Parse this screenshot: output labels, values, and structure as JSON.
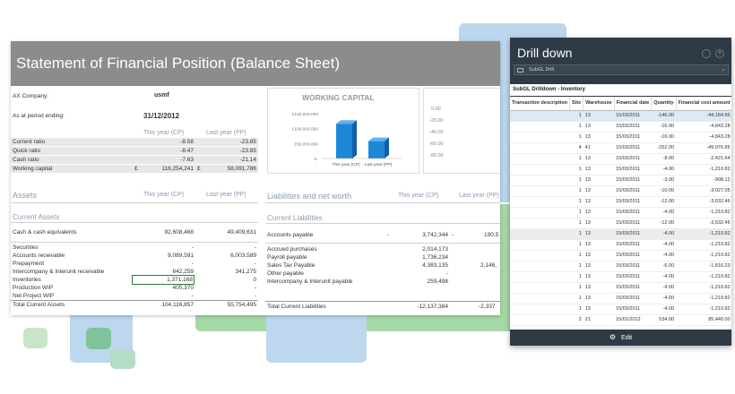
{
  "colors": {
    "accent_blue": "#bcd7ee",
    "accent_green": "#a7d9a6",
    "drill_header": "#2e3a46",
    "title_bar": "#8c8c8c",
    "bar_blue": "#1e88d8"
  },
  "sheet": {
    "title": "Statement of Financial Position (Balance Sheet)",
    "company_label": "AX Company:",
    "company_value": "usmf",
    "period_label": "As at period ending:",
    "period_value": "31/12/2012",
    "col_cp": "This year (CP)",
    "col_pp": "Last year (PP)",
    "ratios": [
      {
        "label": "Current ratio",
        "cp": "-8.58",
        "pp": "-23.85"
      },
      {
        "label": "Quick ratio",
        "cp": "-8.47",
        "pp": "-23.85"
      },
      {
        "label": "Cash ratio",
        "cp": "-7.63",
        "pp": "-21.14"
      },
      {
        "label": "Working capital",
        "cur": "£",
        "cp": "116,254,241",
        "cur2": "£",
        "pp": "58,091,786"
      }
    ],
    "assets_heading": "Assets",
    "current_assets_heading": "Current Assets",
    "cash_row": {
      "label": "Cash & cash equivalents",
      "cp": "92,608,468",
      "pp": "49,409,631"
    },
    "asset_rows": [
      {
        "label": "Securities",
        "cp": "-",
        "pp": "-"
      },
      {
        "label": "Accounts receivable",
        "cp": "9,089,591",
        "pp": "6,003,589"
      },
      {
        "label": "Prepayment",
        "cp": "-",
        "pp": "-"
      },
      {
        "label": "Intercompany & Interunit receivable",
        "cp": "642,259",
        "pp": "341,275"
      },
      {
        "label": "Inventories",
        "cp": "1,371,168",
        "pp": "0"
      },
      {
        "label": "Production WIP",
        "cp": "405,370",
        "pp": "-"
      },
      {
        "label": "Net Project WIP",
        "cp": "-",
        "pp": "-"
      }
    ],
    "total_assets": {
      "label": "Total Current Assets",
      "cp": "104,116,857",
      "pp": "55,754,495"
    },
    "liab_heading": "Liabilities and net worth",
    "current_liab_heading": "Current Liabilities",
    "ap_row": {
      "label": "Accounts payable",
      "dash": "-",
      "cp": "3,742,344",
      "dash2": "-",
      "pp": "190,5"
    },
    "liab_rows": [
      {
        "label": "Accrued purchases",
        "cp": "2,014,173",
        "pp": ""
      },
      {
        "label": "Payroll payable",
        "cp": "1,736,234",
        "pp": ""
      },
      {
        "label": "Sales Tax Payable",
        "cp": "4,383,135",
        "pp": "2,146,"
      },
      {
        "label": "Other payable",
        "cp": "-",
        "pp": ""
      },
      {
        "label": "Intercompany & Interunit payable",
        "cp": "259,498",
        "pp": ""
      }
    ],
    "total_liab": {
      "label": "Total Current Liabilities",
      "cp": "-12,137,384",
      "pp": "-2,337"
    },
    "chart": {
      "title": "WORKING CAPITAL",
      "y_ticks": [
        "£150,000,000",
        "£100,000,000",
        "£50,000,000",
        "£-"
      ],
      "categories": [
        "This year (CP)",
        "Last year (PP)"
      ]
    },
    "chart2_ticks": [
      "0.00",
      "-20.00",
      "-40.00",
      "-60.00",
      "-80.00"
    ]
  },
  "chart_data": {
    "type": "bar",
    "title": "WORKING CAPITAL",
    "categories": [
      "This year (CP)",
      "Last year (PP)"
    ],
    "values": [
      116254241,
      58091786
    ],
    "ylim": [
      0,
      150000000
    ]
  },
  "drill": {
    "title": "Drill down",
    "select_value": "SubGL Drill",
    "subtitle": "SubGL Drilldown - Inventory",
    "columns": [
      "Transaction description",
      "Site",
      "Warehouse",
      "Financial date",
      "Quantity",
      "Financial cost amount"
    ],
    "rows": [
      [
        "",
        "1",
        "13",
        "15/03/2011",
        "-146.00",
        "-44,184.96"
      ],
      [
        "",
        "1",
        "13",
        "15/03/2011",
        "-16.00",
        "-4,843.28"
      ],
      [
        "",
        "1",
        "13",
        "15/03/2011",
        "-16.00",
        "-4,843.28"
      ],
      [
        "",
        "4",
        "41",
        "15/03/2011",
        "-252.00",
        "-49,976.86"
      ],
      [
        "",
        "1",
        "13",
        "15/03/2011",
        "-8.00",
        "-2,421.64"
      ],
      [
        "",
        "1",
        "13",
        "15/03/2011",
        "-4.00",
        "-1,210.82"
      ],
      [
        "",
        "1",
        "13",
        "15/03/2011",
        "-3.00",
        "-908.12"
      ],
      [
        "",
        "1",
        "13",
        "15/03/2011",
        "-10.00",
        "-3,027.05"
      ],
      [
        "",
        "1",
        "13",
        "15/03/2011",
        "-12.00",
        "-3,632.46"
      ],
      [
        "",
        "1",
        "13",
        "15/03/2011",
        "-4.00",
        "-1,210.82"
      ],
      [
        "",
        "1",
        "13",
        "15/03/2011",
        "-12.00",
        "-3,632.46"
      ],
      [
        "",
        "1",
        "13",
        "15/03/2011",
        "-4.00",
        "-1,210.82"
      ],
      [
        "",
        "1",
        "13",
        "15/03/2011",
        "-4.00",
        "-1,210.82"
      ],
      [
        "",
        "1",
        "13",
        "15/03/2011",
        "-4.00",
        "-1,210.82"
      ],
      [
        "",
        "1",
        "13",
        "15/03/2011",
        "-6.00",
        "-1,816.23"
      ],
      [
        "",
        "1",
        "13",
        "15/03/2011",
        "-4.00",
        "-1,210.82"
      ],
      [
        "",
        "1",
        "13",
        "15/03/2011",
        "-4.00",
        "-1,210.82"
      ],
      [
        "",
        "1",
        "13",
        "15/03/2011",
        "-4.00",
        "-1,210.82"
      ],
      [
        "",
        "1",
        "13",
        "15/03/2011",
        "-4.00",
        "-1,210.82"
      ],
      [
        "",
        "2",
        "21",
        "15/01/2012",
        "534.00",
        "85,440.00"
      ]
    ],
    "edit_label": "Edit"
  }
}
